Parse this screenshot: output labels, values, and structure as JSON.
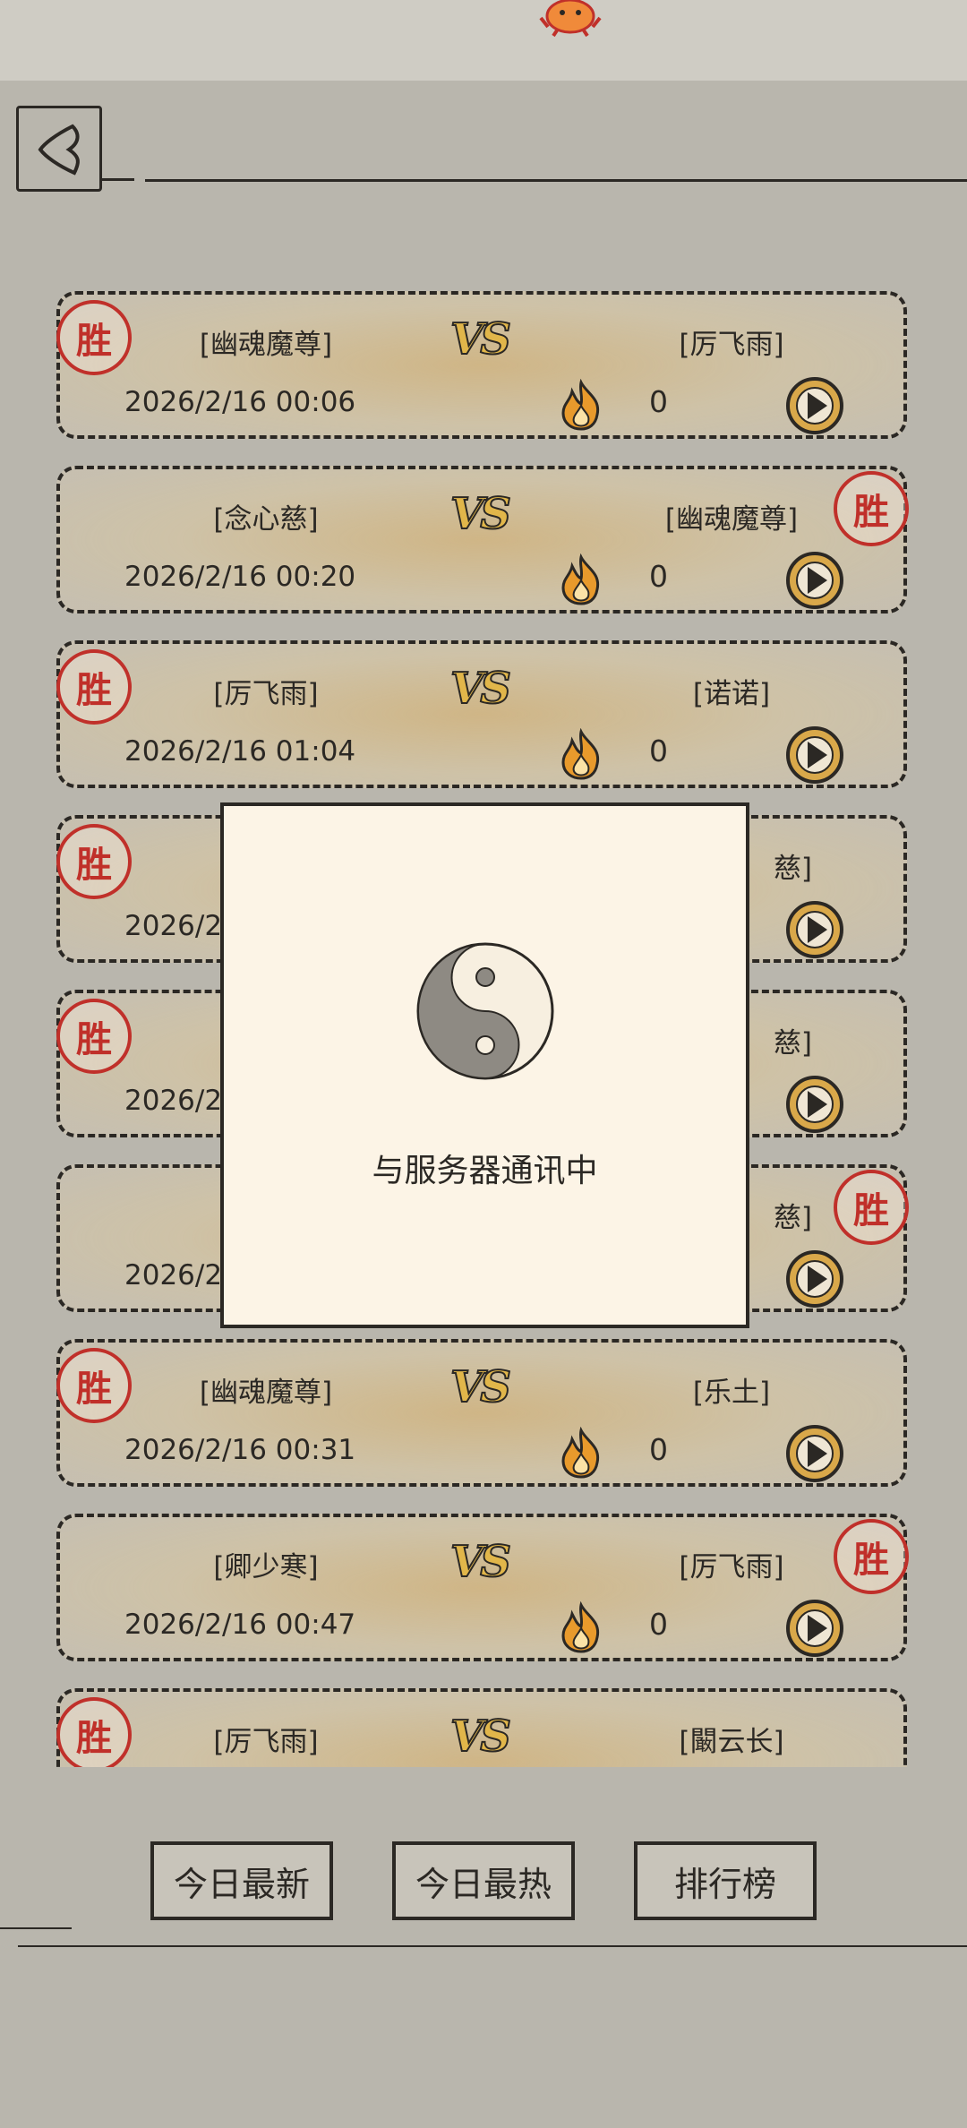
{
  "header": {
    "back_icon": "chevron-left-icon",
    "mascot": "crab-mascot-icon"
  },
  "matches": [
    {
      "player1": "[幽魂魔尊]",
      "player2": "[厉飞雨]",
      "winner": "left",
      "time": "2026/2/16 00:06",
      "hot": "0"
    },
    {
      "player1": "[念心慈]",
      "player2": "[幽魂魔尊]",
      "winner": "right",
      "time": "2026/2/16 00:20",
      "hot": "0"
    },
    {
      "player1": "[厉飞雨]",
      "player2": "[诺诺]",
      "winner": "left",
      "time": "2026/2/16 01:04",
      "hot": "0"
    },
    {
      "player1": "",
      "player2": "慈]",
      "winner": "left",
      "time": "2026/2/",
      "hot": ""
    },
    {
      "player1": "",
      "player2": "慈]",
      "winner": "left",
      "time": "2026/2/",
      "hot": ""
    },
    {
      "player1": "",
      "player2": "慈]",
      "winner": "right",
      "time": "2026/2/",
      "hot": ""
    },
    {
      "player1": "[幽魂魔尊]",
      "player2": "[乐土]",
      "winner": "left",
      "time": "2026/2/16 00:31",
      "hot": "0"
    },
    {
      "player1": "[卿少寒]",
      "player2": "[厉飞雨]",
      "winner": "right",
      "time": "2026/2/16 00:47",
      "hot": "0"
    },
    {
      "player1": "[厉飞雨]",
      "player2": "[闞云长]",
      "winner": "left",
      "time": "",
      "hot": ""
    }
  ],
  "labels": {
    "vs": "VS",
    "win_seal": "胜"
  },
  "tabs": {
    "today_latest": "今日最新",
    "today_hot": "今日最热",
    "ranking": "排行榜"
  },
  "modal": {
    "message": "与服务器通讯中",
    "icon": "taiji-icon"
  },
  "colors": {
    "seal_red": "#c0302a",
    "vs_gold": "#e1b64a",
    "modal_bg": "#fcf4e6",
    "page_bg": "#b9b6ad"
  }
}
